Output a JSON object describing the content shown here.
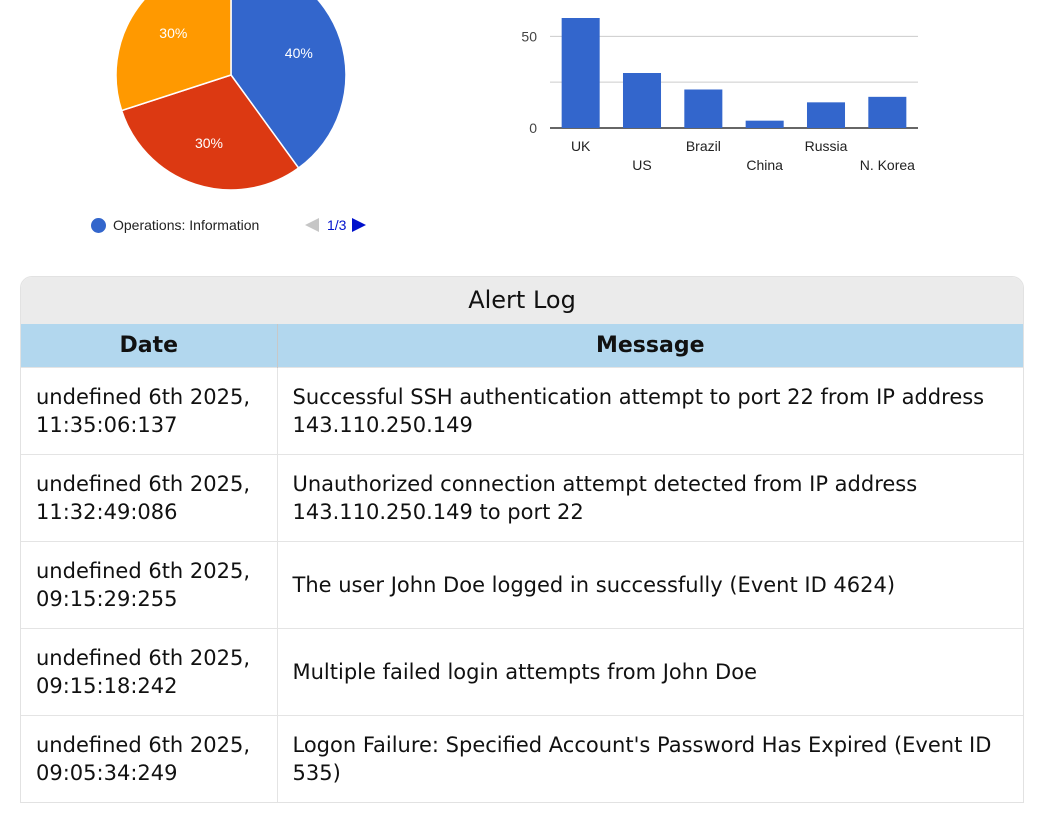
{
  "pie_chart": {
    "chart_data": {
      "type": "pie",
      "slices": [
        {
          "label": "Operations: Information",
          "value": 40,
          "display": "40%",
          "color": "#3366cc"
        },
        {
          "label": "",
          "value": 30,
          "display": "30%",
          "color": "#dc3912"
        },
        {
          "label": "",
          "value": 30,
          "display": "30%",
          "color": "#ff9900"
        }
      ]
    },
    "legend_label": "Operations: Information",
    "legend_color": "#3366cc",
    "pager_text": "1/3"
  },
  "bar_chart": {
    "chart_data": {
      "type": "bar",
      "categories": [
        "UK",
        "US",
        "Brazil",
        "China",
        "Russia",
        "N. Korea"
      ],
      "values": [
        60,
        30,
        21,
        4,
        14,
        17
      ],
      "ylim": [
        0,
        60
      ],
      "yticks": [
        "0",
        "50"
      ],
      "color": "#3366cc",
      "grid": true
    }
  },
  "alert_log": {
    "title": "Alert Log",
    "columns": [
      "Date",
      "Message"
    ],
    "rows": [
      {
        "date": "undefined 6th 2025, 11:35:06:137",
        "message": "Successful SSH authentication attempt to port 22 from IP address 143.110.250.149"
      },
      {
        "date": "undefined 6th 2025, 11:32:49:086",
        "message": "Unauthorized connection attempt detected from IP address 143.110.250.149 to port 22"
      },
      {
        "date": "undefined 6th 2025, 09:15:29:255",
        "message": "The user John Doe logged in successfully (Event ID 4624)"
      },
      {
        "date": "undefined 6th 2025, 09:15:18:242",
        "message": "Multiple failed login attempts from John Doe"
      },
      {
        "date": "undefined 6th 2025, 09:05:34:249",
        "message": "Logon Failure: Specified Account's Password Has Expired (Event ID 535)"
      }
    ]
  }
}
